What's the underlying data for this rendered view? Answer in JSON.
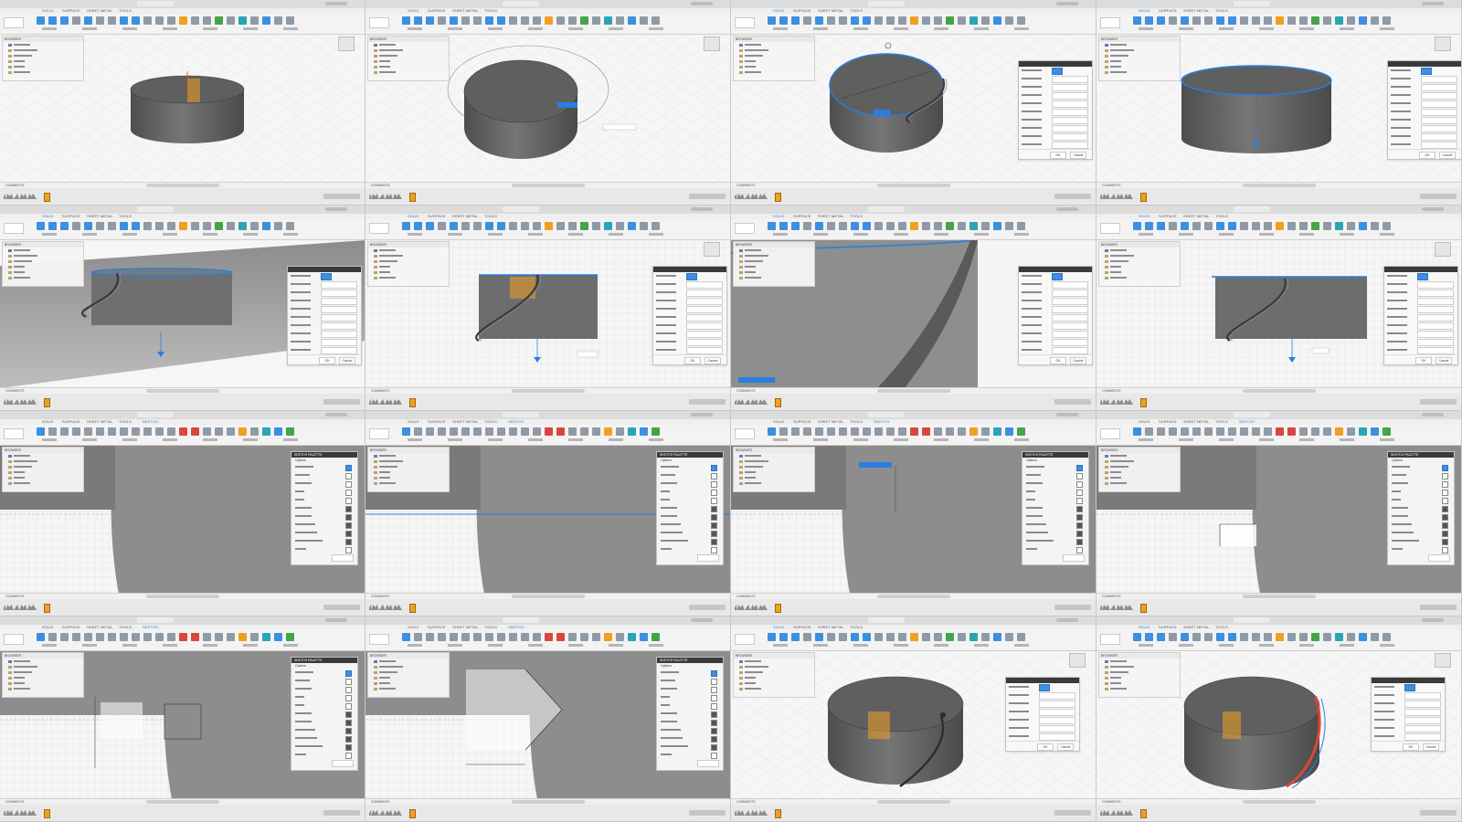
{
  "sheet": {
    "frame_count": 16,
    "frames": [
      {
        "mode": "solid",
        "view": "cylinder-iso"
      },
      {
        "mode": "solid",
        "view": "cylinder-circle"
      },
      {
        "mode": "solid",
        "view": "coil-start"
      },
      {
        "mode": "solid",
        "view": "coil-panel"
      },
      {
        "mode": "solid",
        "view": "coil-side-low"
      },
      {
        "mode": "solid",
        "view": "coil-front"
      },
      {
        "mode": "solid",
        "view": "coil-zoom"
      },
      {
        "mode": "solid",
        "view": "coil-front-2"
      },
      {
        "mode": "sketch",
        "view": "sketch-1"
      },
      {
        "mode": "sketch",
        "view": "sketch-2"
      },
      {
        "mode": "sketch",
        "view": "sketch-3"
      },
      {
        "mode": "sketch",
        "view": "sketch-4"
      },
      {
        "mode": "sketch",
        "view": "sketch-5"
      },
      {
        "mode": "sketch",
        "view": "sketch-6"
      },
      {
        "mode": "solid",
        "view": "sweep-1"
      },
      {
        "mode": "solid",
        "view": "sweep-2"
      }
    ]
  },
  "ui": {
    "tabs": [
      "SOLID",
      "SURFACE",
      "SHEET METAL",
      "TOOLS",
      "SKETCH"
    ],
    "design_label": "",
    "browser_header": "BROWSER",
    "comments_label": "COMMENTS",
    "palette_header": "SKETCH PALETTE",
    "palette_options_label": "Options",
    "ok_label": "OK",
    "cancel_label": "Cancel"
  },
  "colors": {
    "accent_blue": "#1f77d0",
    "body_gray": "#6d6d6d",
    "edge_blue": "#2a7de1",
    "sweep_red": "#d8473d",
    "tool_orange": "#f0a020",
    "finish_green": "#43a547"
  }
}
